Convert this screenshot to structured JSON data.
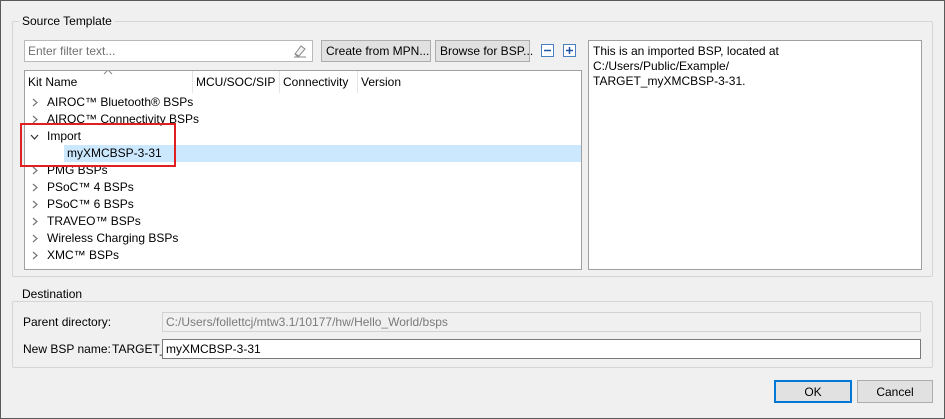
{
  "source_template": {
    "title": "Source Template",
    "filter": {
      "placeholder": "Enter filter text...",
      "value": ""
    },
    "buttons": {
      "create_from_mpn": "Create from MPN...",
      "browse_for_bsp": "Browse for BSP..."
    },
    "columns": [
      "Kit Name",
      "MCU/SOC/SIP",
      "Connectivity",
      "Version"
    ],
    "tree": [
      {
        "label": "AIROC™ Bluetooth® BSPs",
        "expanded": false
      },
      {
        "label": "AIROC™ Connectivity BSPs",
        "expanded": false
      },
      {
        "label": "Import",
        "expanded": true
      },
      {
        "label": "myXMCBSP-3-31",
        "child": true,
        "selected": true
      },
      {
        "label": "PMG BSPs",
        "expanded": false
      },
      {
        "label": "PSoC™ 4 BSPs",
        "expanded": false
      },
      {
        "label": "PSoC™ 6 BSPs",
        "expanded": false
      },
      {
        "label": "TRAVEO™ BSPs",
        "expanded": false
      },
      {
        "label": "Wireless Charging BSPs",
        "expanded": false
      },
      {
        "label": "XMC™ BSPs",
        "expanded": false
      }
    ],
    "description_line1": "This is an imported BSP, located at C:/Users/Public/Example/",
    "description_line2": "TARGET_myXMCBSP-3-31."
  },
  "destination": {
    "title": "Destination",
    "parent_directory_label": "Parent directory:",
    "parent_directory_value": "C:/Users/follettcj/mtw3.1/10177/hw/Hello_World/bsps",
    "new_bsp_name_label": "New BSP name:",
    "new_bsp_prefix": "TARGET_",
    "new_bsp_value": "myXMCBSP-3-31"
  },
  "footer": {
    "ok_label": "OK",
    "cancel_label": "Cancel"
  },
  "colors": {
    "selection": "#cce8ff",
    "highlight_box": "#e02020",
    "dialog_bg": "#f0f0f0"
  }
}
